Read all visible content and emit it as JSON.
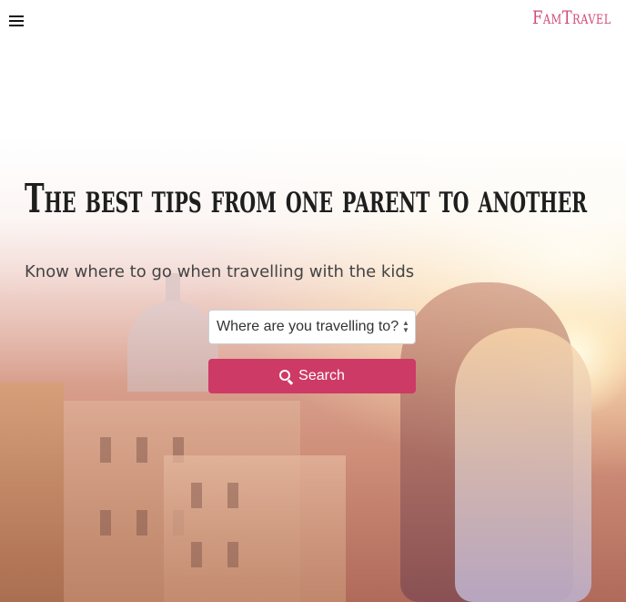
{
  "header": {
    "menu_icon": "hamburger-menu-icon",
    "logo": "FamTravel",
    "brand_color": "#d14a76"
  },
  "hero": {
    "headline": "The best tips from one parent to another",
    "subtitle": "Know where to go when travelling with the kids"
  },
  "search": {
    "destination_select_value": "Where are you travelling to?",
    "select_arrows_icon": "up-down-arrows-icon",
    "button_label": "Search",
    "button_icon": "search-icon",
    "button_color": "#cd3a66"
  }
}
